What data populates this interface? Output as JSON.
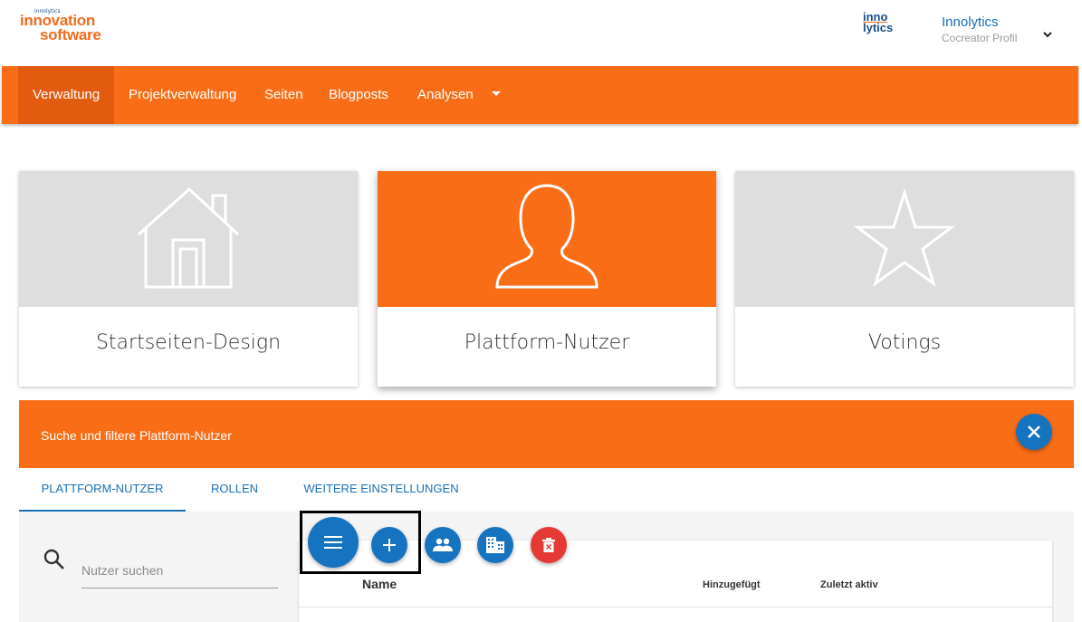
{
  "header": {
    "logo_tiny": "innolytics",
    "logo_line1": "innovation",
    "logo_line2": "software",
    "brand_top": "inno",
    "brand_bottom": "lytics",
    "profile_name": "Innolytics",
    "profile_role": "Cocreator Profil",
    "chevron_icon": "chevron-down-icon"
  },
  "nav": {
    "items": [
      {
        "label": "Verwaltung",
        "active": true
      },
      {
        "label": "Projektverwaltung",
        "active": false
      },
      {
        "label": "Seiten",
        "active": false
      },
      {
        "label": "Blogposts",
        "active": false
      },
      {
        "label": "Analysen",
        "active": false
      }
    ],
    "more_icon": "caret-down-icon"
  },
  "cards": [
    {
      "label": "Startseiten-Design",
      "icon": "house-icon",
      "active": false
    },
    {
      "label": "Plattform-Nutzer",
      "icon": "user-silhouette-icon",
      "active": true
    },
    {
      "label": "Votings",
      "icon": "star-icon",
      "active": false
    }
  ],
  "panel": {
    "title": "Suche und filtere Plattform-Nutzer",
    "close_icon": "close-icon",
    "tabs": [
      {
        "label": "PLATTFORM-NUTZER",
        "active": true
      },
      {
        "label": "ROLLEN",
        "active": false
      },
      {
        "label": "WEITERE EINSTELLUNGEN",
        "active": false
      }
    ],
    "search": {
      "placeholder": "Nutzer suchen",
      "icon": "search-icon"
    },
    "actions": [
      {
        "name": "menu-button",
        "icon": "menu-icon",
        "color": "#1573bf"
      },
      {
        "name": "add-user-button",
        "icon": "plus-icon",
        "color": "#1573bf"
      },
      {
        "name": "groups-button",
        "icon": "people-icon",
        "color": "#1573bf"
      },
      {
        "name": "organization-button",
        "icon": "building-icon",
        "color": "#1573bf"
      },
      {
        "name": "delete-button",
        "icon": "trash-icon",
        "color": "#e53935"
      }
    ],
    "table_headers": {
      "name": "Name",
      "added": "Hinzugefügt",
      "last_active": "Zuletzt aktiv"
    }
  },
  "colors": {
    "accent": "#f96d16",
    "accent_dark": "#e35b0f",
    "primary_blue": "#1573bf",
    "danger": "#e53935"
  }
}
